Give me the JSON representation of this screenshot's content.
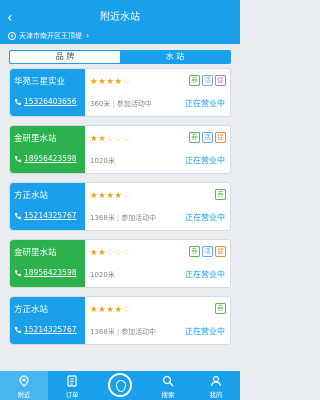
{
  "header": {
    "title": "附近水站",
    "back_icon": "chevron-left-icon"
  },
  "location": {
    "text": "天津市南开区王顶堤",
    "icon": "location-pin-icon"
  },
  "tabs": [
    {
      "label": "品 牌"
    },
    {
      "label": "水 站",
      "active": true
    }
  ],
  "stations": [
    {
      "name": "华苑三星实业",
      "phone": "15326403656",
      "rating": 4,
      "distance": "360米",
      "activity": "参加活动中",
      "status": "正在营业中",
      "badges": [
        "券",
        "活",
        "促"
      ],
      "color": "blue"
    },
    {
      "name": "金研里水站",
      "phone": "18956423598",
      "rating": 2,
      "distance": "1020米",
      "activity": "",
      "status": "正在营业中",
      "badges": [
        "券",
        "活",
        "促"
      ],
      "color": "green"
    },
    {
      "name": "方正水站",
      "phone": "15214325767",
      "rating": 4,
      "distance": "1368米",
      "activity": "参加活动中",
      "status": "正在营业中",
      "badges": [
        "券"
      ],
      "color": "blue"
    },
    {
      "name": "金研里水站",
      "phone": "18956423598",
      "rating": 2,
      "distance": "1020米",
      "activity": "",
      "status": "正在营业中",
      "badges": [
        "券",
        "活",
        "促"
      ],
      "color": "green"
    },
    {
      "name": "方正水站",
      "phone": "15214325767",
      "rating": 4,
      "distance": "1368米",
      "activity": "参加活动中",
      "status": "正在营业中",
      "badges": [
        "券"
      ],
      "color": "blue"
    }
  ],
  "nav": [
    {
      "label": "附近",
      "icon": "location-icon",
      "active": true
    },
    {
      "label": "订单",
      "icon": "order-icon"
    },
    {
      "label": "",
      "icon": "water-drop-icon"
    },
    {
      "label": "搜索",
      "icon": "search-icon"
    },
    {
      "label": "我的",
      "icon": "user-icon"
    }
  ],
  "colors": {
    "primary": "#1aa0ea",
    "green": "#2bb24c",
    "star": "#f3a20c"
  }
}
